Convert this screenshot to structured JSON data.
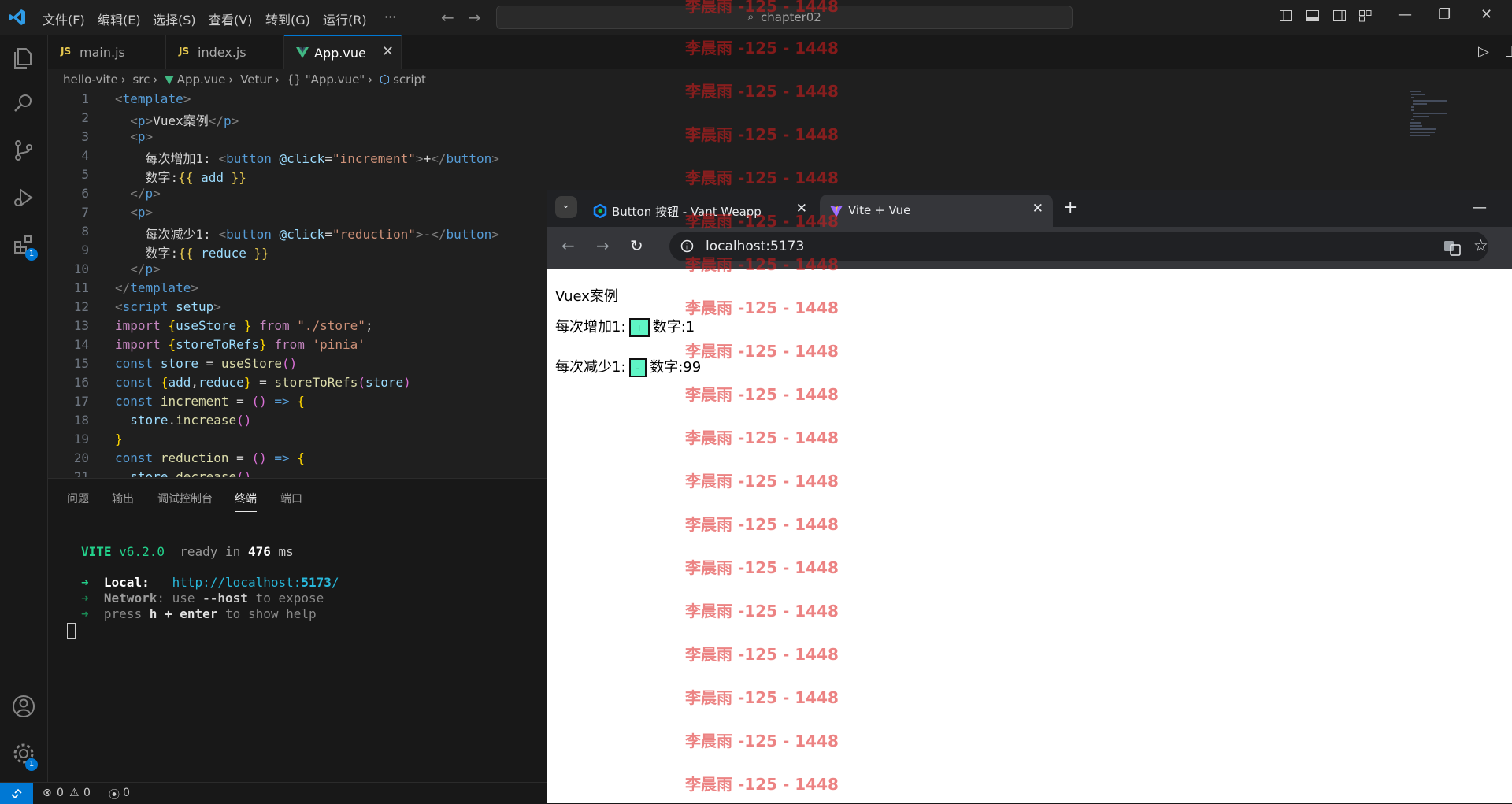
{
  "titlebar": {
    "menus": [
      "文件(F)",
      "编辑(E)",
      "选择(S)",
      "查看(V)",
      "转到(G)",
      "运行(R)",
      "···"
    ],
    "search_text": "chapter02"
  },
  "activitybar": {
    "extensions_badge": "1",
    "settings_badge": "1"
  },
  "editor_tabs": [
    {
      "label": "main.js",
      "icon": "JS"
    },
    {
      "label": "index.js",
      "icon": "JS"
    },
    {
      "label": "App.vue",
      "icon": "vue",
      "active": true
    }
  ],
  "breadcrumb": [
    "hello-vite",
    "src",
    "App.vue",
    "Vetur",
    "{} \"App.vue\"",
    "script"
  ],
  "code": {
    "line_numbers": [
      "1",
      "2",
      "3",
      "4",
      "5",
      "6",
      "7",
      "8",
      "9",
      "10",
      "11",
      "12",
      "13",
      "14",
      "15",
      "16",
      "17",
      "18",
      "19",
      "20",
      "21"
    ]
  },
  "panel": {
    "tabs": [
      "问题",
      "输出",
      "调试控制台",
      "终端",
      "端口"
    ],
    "active_tab": "终端",
    "terminal": {
      "vite_name": "VITE",
      "vite_version": "v6.2.0",
      "ready": "ready in",
      "ready_time": "476",
      "ready_unit": "ms",
      "local_label": "Local:",
      "local_url_a": "http://localhost:",
      "local_url_port": "5173",
      "local_url_b": "/",
      "network_label": "Network",
      "network_rest_a": ": use ",
      "network_host": "--host",
      "network_rest_b": " to expose",
      "press": "press ",
      "h_key": "h + enter",
      "press_rest": " to show help"
    }
  },
  "statusbar": {
    "errors": "0",
    "warnings": "0",
    "ports": "0"
  },
  "browser": {
    "tabs": [
      {
        "label": "Button 按钮 - Vant Weapp"
      },
      {
        "label": "Vite + Vue",
        "active": true
      }
    ],
    "url": "localhost:5173",
    "page": {
      "heading": "Vuex案例",
      "inc_label": "每次增加1:",
      "inc_button": "+",
      "inc_value_label": "数字:1",
      "dec_label": "每次减少1:",
      "dec_button": "-",
      "dec_value_label": "数字:99"
    }
  },
  "watermark": "李晨雨 -125 - 1448",
  "colors": {
    "accent": "#0078d4",
    "page_button": "#5ff5c5",
    "watermark": "#dc1e1e"
  }
}
